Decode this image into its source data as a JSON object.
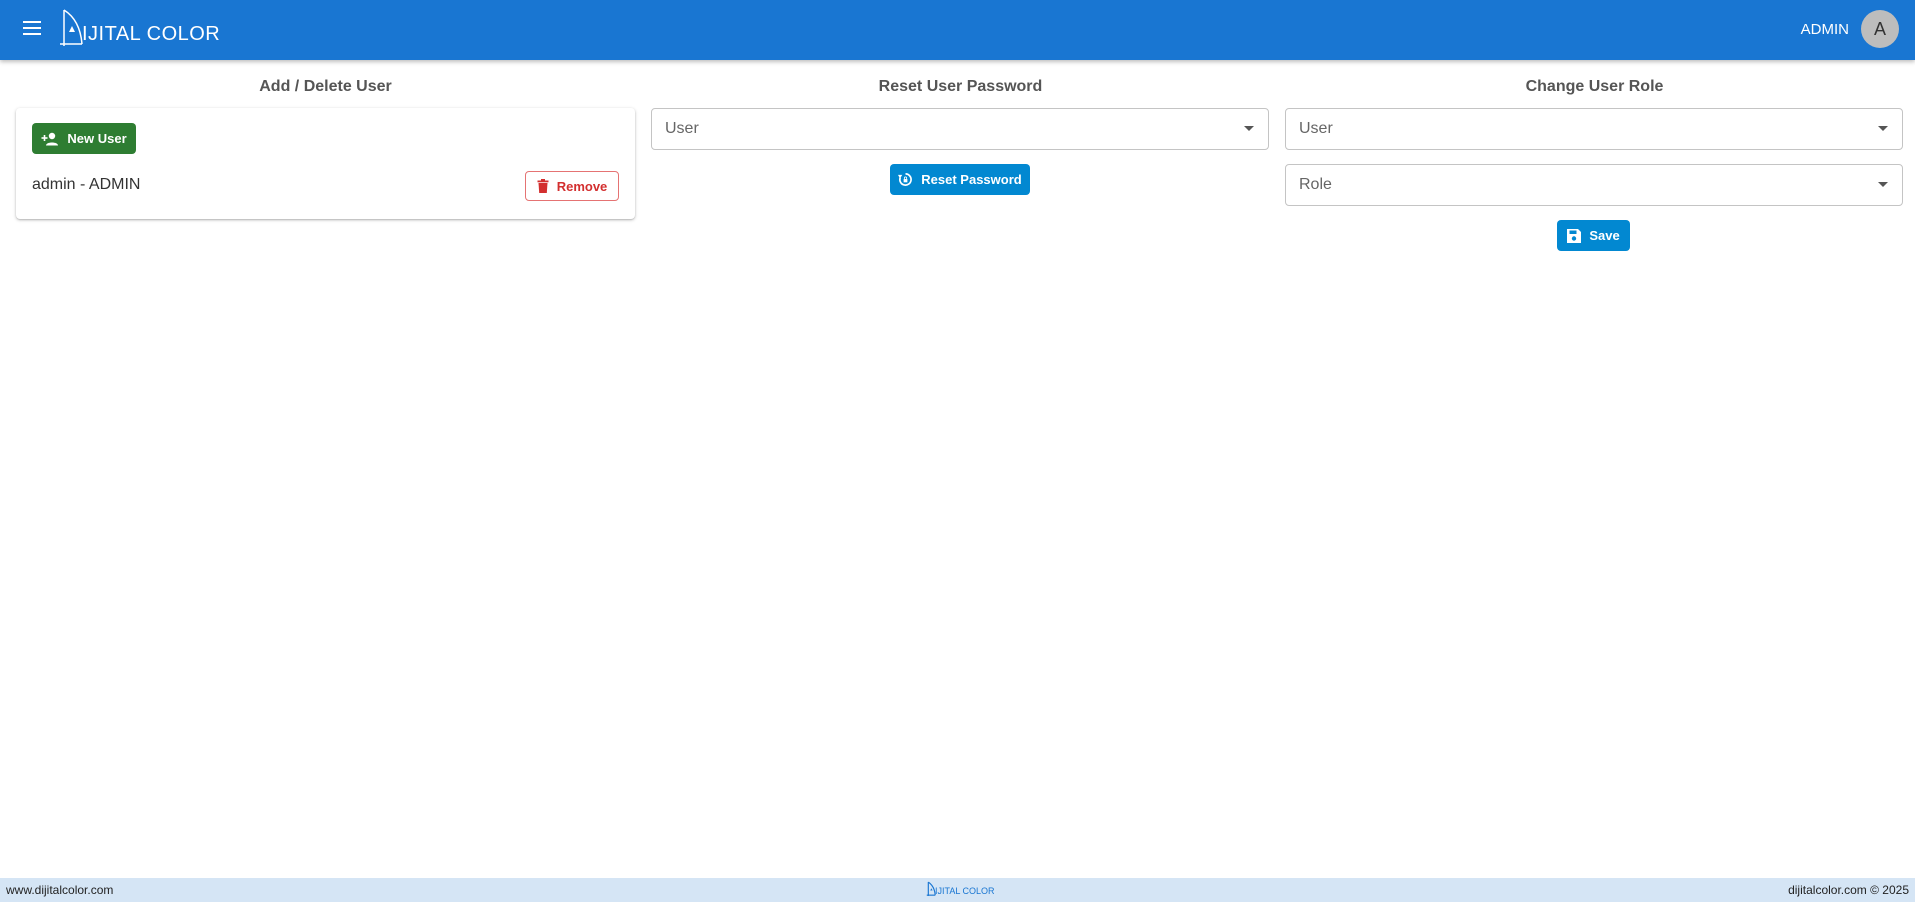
{
  "header": {
    "logo_text": "IJITAL COLOR",
    "user_name": "ADMIN",
    "avatar_letter": "A"
  },
  "add_delete": {
    "title": "Add / Delete User",
    "new_user_label": "New User",
    "users": [
      {
        "label": "admin - ADMIN",
        "remove_label": "Remove"
      }
    ]
  },
  "reset_password": {
    "title": "Reset User Password",
    "user_select_label": "User",
    "button_label": "Reset Password"
  },
  "change_role": {
    "title": "Change User Role",
    "user_select_label": "User",
    "role_select_label": "Role",
    "save_label": "Save"
  },
  "footer": {
    "left": "www.dijitalcolor.com",
    "logo_text": "IJITAL COLOR",
    "right": "dijitalcolor.com © 2025"
  },
  "colors": {
    "appbar": "#1976d2",
    "new_user_button": "#2e7d32",
    "primary_button": "#0288d1",
    "remove_button": "#d32f2f",
    "footer_bg": "#d5e5f5"
  }
}
